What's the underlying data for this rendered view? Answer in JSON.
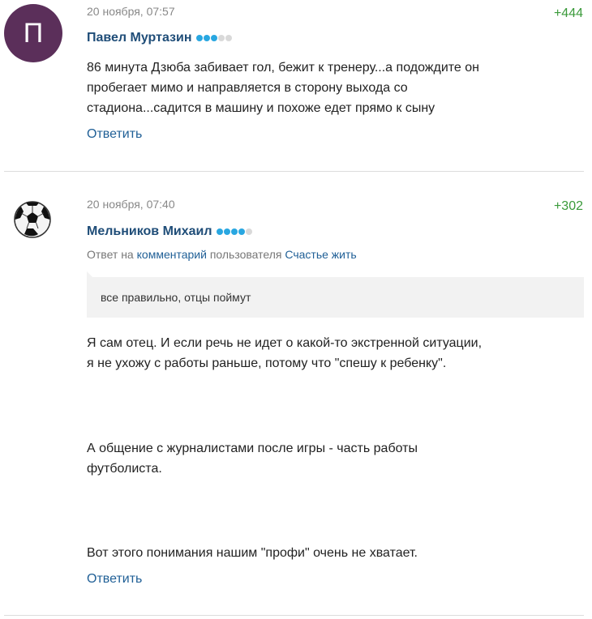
{
  "comments": [
    {
      "avatar_letter": "П",
      "date": "20 ноября, 07:57",
      "rating": "+444",
      "author": "Павел Муртазин",
      "rank_dots_filled": 3,
      "rank_dots_total": 5,
      "text_lines": [
        "86 минута Дзюба забивает гол, бежит к тренеру...а подождите он",
        "пробегает мимо и направляется в сторону выхода со",
        "стадиона...садится в машину и похоже едет прямо к сыну"
      ],
      "reply_label": "Ответить"
    },
    {
      "avatar_icon": "soccer-ball-icon",
      "date": "20 ноября, 07:40",
      "rating": "+302",
      "author": "Мельников Михаил",
      "rank_dots_filled": 4,
      "rank_dots_total": 5,
      "reply_to": {
        "prefix": "Ответ на",
        "comment_link": "комментарий",
        "middle": "пользователя",
        "user_link": "Счастье жить"
      },
      "quote": "все правильно, отцы поймут",
      "text_lines": [
        "Я сам отец. И если речь не идет о какой-то экстренной ситуации,",
        "я не ухожу с работы раньше, потому что \"спешу к ребенку\".",
        "А общение с журналистами после игры - часть работы",
        "футболиста.",
        "Вот этого понимания нашим \"профи\" очень не хватает."
      ],
      "reply_label": "Ответить"
    }
  ],
  "colors": {
    "author": "#1f4d78",
    "rating": "#3a9a3a",
    "link": "#1f5f96",
    "rank_dot": "#29a7e1",
    "avatar_bg": "#5b2f5a"
  }
}
